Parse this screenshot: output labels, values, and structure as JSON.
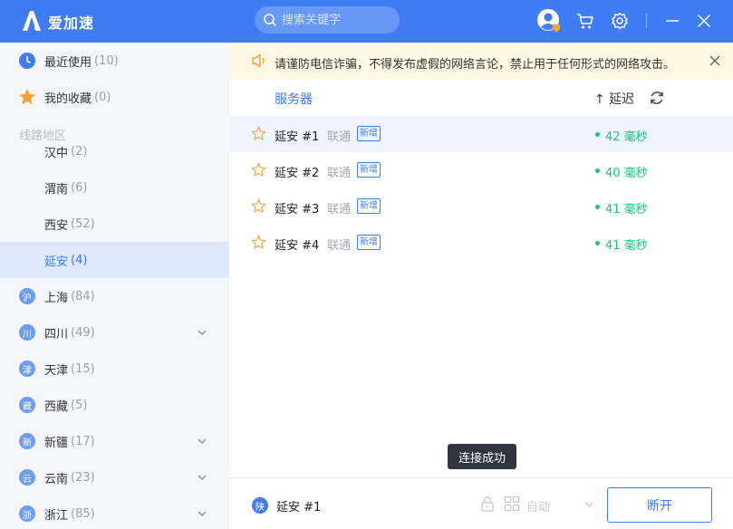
{
  "app": {
    "title": "爱加速"
  },
  "search": {
    "placeholder": "搜索关键字"
  },
  "sidebar": {
    "top_items": [
      {
        "label": "最近使用",
        "count": "(10)"
      },
      {
        "label": "我的收藏",
        "count": "(0)"
      }
    ],
    "section_title": "线路地区",
    "regions": [
      {
        "label": "汉中",
        "count": "(2)"
      },
      {
        "label": "渭南",
        "count": "(6)"
      },
      {
        "label": "西安",
        "count": "(52)"
      },
      {
        "label": "延安",
        "count": "(4)"
      },
      {
        "badge": "沪",
        "label": "上海",
        "count": "(84)"
      },
      {
        "badge": "川",
        "label": "四川",
        "count": "(49)"
      },
      {
        "badge": "津",
        "label": "天津",
        "count": "(15)"
      },
      {
        "badge": "藏",
        "label": "西藏",
        "count": "(5)"
      },
      {
        "badge": "新",
        "label": "新疆",
        "count": "(17)"
      },
      {
        "badge": "云",
        "label": "云南",
        "count": "(23)"
      },
      {
        "badge": "浙",
        "label": "浙江",
        "count": "(85)"
      }
    ]
  },
  "notice": {
    "text": "请谨防电信诈骗，不得发布虚假的网络言论，禁止用于任何形式的网络攻击。"
  },
  "list": {
    "col_server": "服务器",
    "col_latency": "↑ 延迟",
    "rows": [
      {
        "name": "延安 #1",
        "isp": "联通",
        "tag": "新增",
        "latency": "42 毫秒"
      },
      {
        "name": "延安 #2",
        "isp": "联通",
        "tag": "新增",
        "latency": "40 毫秒"
      },
      {
        "name": "延安 #3",
        "isp": "联通",
        "tag": "新增",
        "latency": "41 毫秒"
      },
      {
        "name": "延安 #4",
        "isp": "联通",
        "tag": "新增",
        "latency": "41 毫秒"
      }
    ]
  },
  "toast": {
    "text": "连接成功"
  },
  "footer": {
    "region_badge": "陕",
    "current_server": "延安 #1",
    "mode": "自动",
    "disconnect_label": "断开"
  },
  "colors": {
    "accent": "#3d7cf2",
    "latency_good": "#1bc37a",
    "notice_bg": "#fdf6e3"
  }
}
